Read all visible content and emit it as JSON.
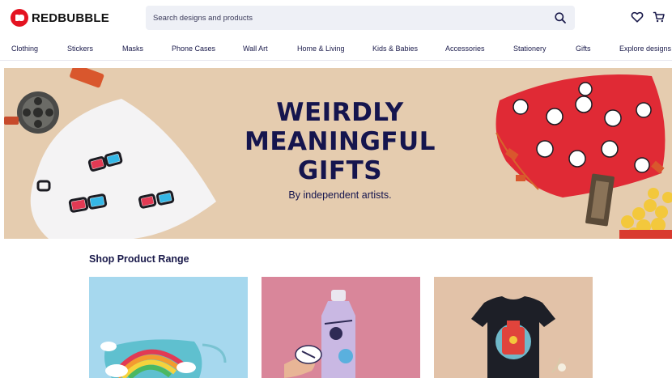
{
  "header": {
    "logo_text": "REDBUBBLE",
    "search_placeholder": "Search designs and products",
    "icons": [
      "search-icon",
      "heart-icon",
      "cart-icon"
    ]
  },
  "nav": {
    "items": [
      {
        "label": "Clothing"
      },
      {
        "label": "Stickers"
      },
      {
        "label": "Masks"
      },
      {
        "label": "Phone Cases"
      },
      {
        "label": "Wall Art"
      },
      {
        "label": "Home & Living"
      },
      {
        "label": "Kids & Babies"
      },
      {
        "label": "Accessories"
      },
      {
        "label": "Stationery"
      },
      {
        "label": "Gifts"
      },
      {
        "label": "Explore designs"
      }
    ]
  },
  "hero": {
    "title_line1": "WEIRDLY",
    "title_line2": "MEANINGFUL",
    "title_line3": "GIFTS",
    "subtitle": "By independent artists.",
    "background_color": "#e5ccaf"
  },
  "shop": {
    "title": "Shop Product Range",
    "cards": [
      {
        "product": "mask",
        "background_color": "#a6d8ee"
      },
      {
        "product": "water-bottle",
        "background_color": "#d9869a"
      },
      {
        "product": "t-shirt",
        "background_color": "#e2c2a8"
      }
    ]
  },
  "colors": {
    "brand": "#e41321",
    "text": "#19194a",
    "search_bg": "#eef0f6"
  }
}
